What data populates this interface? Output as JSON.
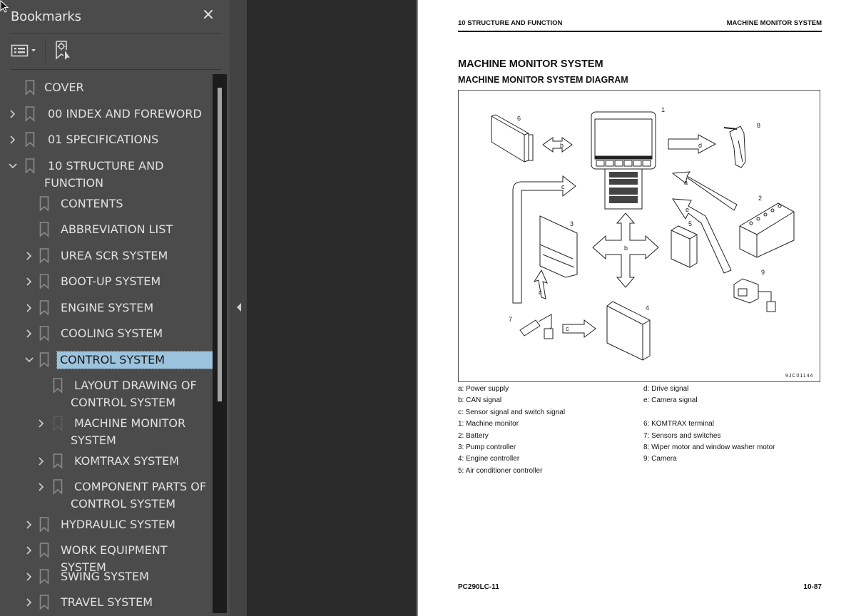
{
  "sidebar": {
    "title": "Bookmarks",
    "close_icon": "×",
    "toolbar": {
      "options_icon": "list-options-icon",
      "find_icon": "find-current-bookmark-icon"
    },
    "items": [
      {
        "label": "COVER",
        "level": 0,
        "expander": "none"
      },
      {
        "label": "00 INDEX AND FOREWORD",
        "level": 0,
        "expander": "collapsed"
      },
      {
        "label": "01 SPECIFICATIONS",
        "level": 0,
        "expander": "collapsed"
      },
      {
        "label": "10 STRUCTURE AND FUNCTION",
        "level": 0,
        "expander": "expanded"
      },
      {
        "label": "CONTENTS",
        "level": 1,
        "expander": "none"
      },
      {
        "label": "ABBREVIATION LIST",
        "level": 1,
        "expander": "none"
      },
      {
        "label": "UREA SCR SYSTEM",
        "level": 1,
        "expander": "collapsed"
      },
      {
        "label": "BOOT-UP SYSTEM",
        "level": 1,
        "expander": "collapsed"
      },
      {
        "label": "ENGINE SYSTEM",
        "level": 1,
        "expander": "collapsed"
      },
      {
        "label": "COOLING SYSTEM",
        "level": 1,
        "expander": "collapsed"
      },
      {
        "label": "CONTROL SYSTEM",
        "level": 1,
        "expander": "expanded",
        "selected": true
      },
      {
        "label": "LAYOUT DRAWING OF CONTROL SYSTEM",
        "level": 2,
        "expander": "none"
      },
      {
        "label": "MACHINE MONITOR SYSTEM",
        "level": 2,
        "expander": "collapsed"
      },
      {
        "label": "KOMTRAX SYSTEM",
        "level": 2,
        "expander": "collapsed"
      },
      {
        "label": "COMPONENT PARTS OF CONTROL SYSTEM",
        "level": 2,
        "expander": "collapsed"
      },
      {
        "label": "HYDRAULIC SYSTEM",
        "level": 1,
        "expander": "collapsed"
      },
      {
        "label": "WORK EQUIPMENT SYSTEM",
        "level": 1,
        "expander": "collapsed"
      },
      {
        "label": "SWING SYSTEM",
        "level": 1,
        "expander": "collapsed"
      },
      {
        "label": "TRAVEL SYSTEM",
        "level": 1,
        "expander": "collapsed"
      }
    ],
    "scroll_position": 0.03,
    "selection_color": "#9cc3dd"
  },
  "page": {
    "header_left": "10 STRUCTURE AND FUNCTION",
    "header_right": "MACHINE MONITOR SYSTEM",
    "title": "MACHINE MONITOR SYSTEM",
    "subtitle": "MACHINE MONITOR SYSTEM DIAGRAM",
    "diagram": {
      "code": "9JC01144",
      "component_numbers": [
        "1",
        "2",
        "3",
        "4",
        "5",
        "6",
        "7",
        "8",
        "9"
      ],
      "signal_letters": {
        "a": "a",
        "b": "b",
        "c": "c",
        "d": "d",
        "e": "e"
      }
    },
    "legend_left": [
      "a: Power supply",
      "b: CAN signal",
      "c: Sensor signal and switch signal",
      "1: Machine monitor",
      "2: Battery",
      "3: Pump controller",
      "4: Engine controller",
      "5: Air conditioner controller"
    ],
    "legend_right": [
      "d: Drive signal",
      "e: Camera signal",
      "",
      "6: KOMTRAX terminal",
      "7: Sensors and switches",
      "8: Wiper motor and window washer motor",
      "9: Camera"
    ],
    "footer_left": "PC290LC-11",
    "footer_right": "10-87"
  }
}
